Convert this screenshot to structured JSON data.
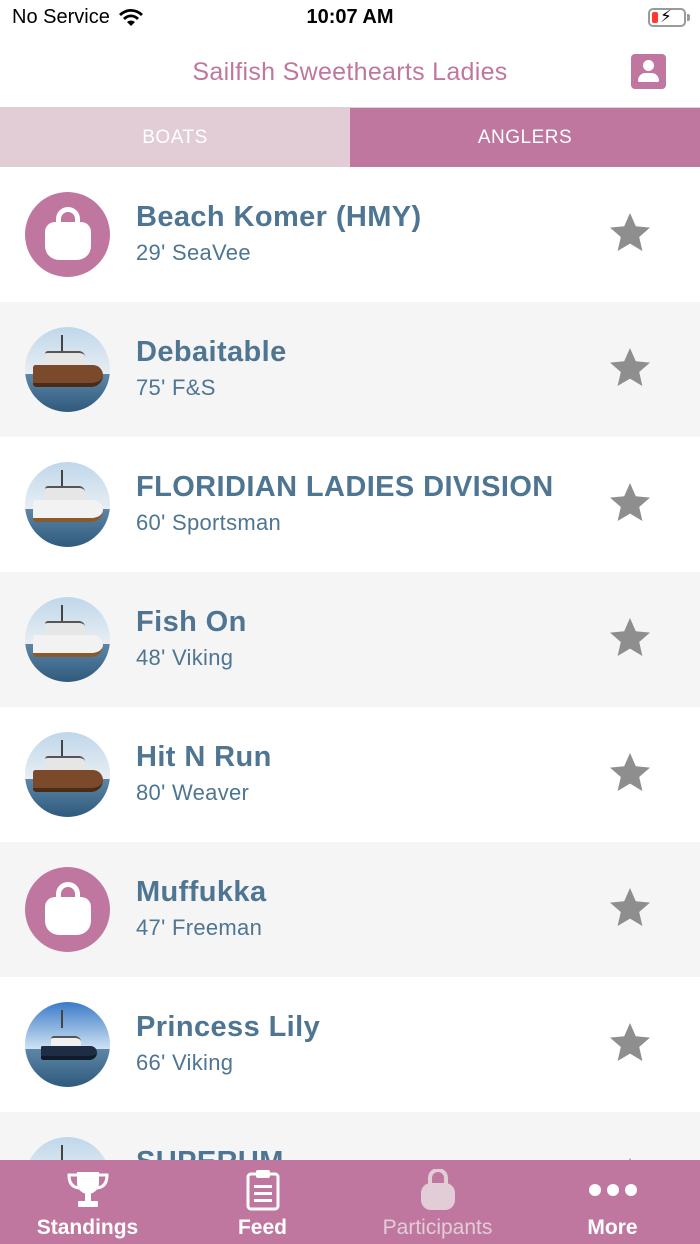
{
  "status": {
    "carrier": "No Service",
    "time": "10:07 AM"
  },
  "nav": {
    "title": "Sailfish Sweethearts Ladies"
  },
  "tabs": {
    "boats": "BOATS",
    "anglers": "ANGLERS"
  },
  "boats": [
    {
      "name": "Beach Komer (HMY)",
      "desc": "29' SeaVee",
      "image": "placeholder-kettlebell"
    },
    {
      "name": "Debaitable",
      "desc": "75' F&S",
      "image": "boat-photo"
    },
    {
      "name": "FLORIDIAN LADIES DIVISION",
      "desc": "60' Sportsman",
      "image": "boat-photo"
    },
    {
      "name": "Fish On",
      "desc": "48' Viking",
      "image": "boat-photo"
    },
    {
      "name": "Hit N Run",
      "desc": "80' Weaver",
      "image": "boat-photo"
    },
    {
      "name": "Muffukka",
      "desc": "47' Freeman",
      "image": "placeholder-kettlebell"
    },
    {
      "name": "Princess Lily",
      "desc": "66' Viking",
      "image": "boat-photo"
    },
    {
      "name": "SUPERUM",
      "desc": "",
      "image": "boat-photo"
    }
  ],
  "tabbar": {
    "standings": "Standings",
    "feed": "Feed",
    "participants": "Participants",
    "more": "More"
  },
  "colors": {
    "accent": "#c0779f",
    "accent_light": "#e2cdd7",
    "text_blue": "#4e7592",
    "star_gray": "#8e8e8e"
  }
}
